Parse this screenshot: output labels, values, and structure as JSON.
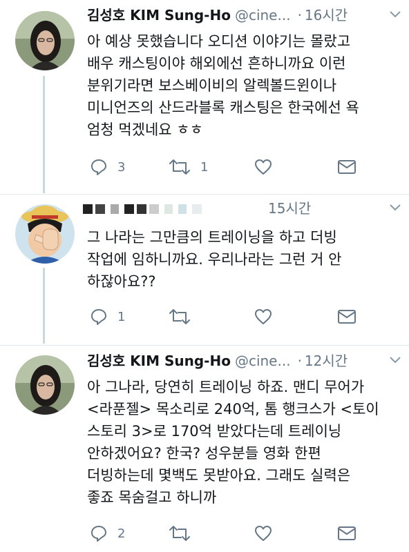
{
  "colors": {
    "text": "#14171a",
    "muted": "#657786",
    "line": "#ccd6dd",
    "divider": "#e1e8ed"
  },
  "tweets": [
    {
      "author_name": "김성호 KIM Sung-Ho",
      "handle": "@cine...",
      "separator": "·",
      "time": "16시간",
      "lines": [
        "아 예상 못했습니다 오디션 이야기는 몰랐고",
        "배우 캐스팅이야 해외에선 흔하니까요 이런",
        "분위기라면 보스베이비의 알렉볼드윈이나",
        "미니언즈의 산드라블록 캐스팅은 한국에선 욕",
        "엄청 먹겠네요 ㅎㅎ"
      ],
      "reply_count": "3",
      "retweet_count": "1",
      "icons": [
        "reply-icon",
        "retweet-icon",
        "like-icon",
        "message-icon",
        "chevron-down-icon"
      ]
    },
    {
      "author_name": "",
      "author_redacted": true,
      "handle": "",
      "separator": "",
      "time": "15시간",
      "lines": [
        "그 나라는 그만큼의 트레이닝을 하고 더빙",
        "작업에 임하니까요. 우리나라는 그런 거 안",
        "하잖아요??"
      ],
      "reply_count": "1",
      "retweet_count": "",
      "icons": [
        "reply-icon",
        "retweet-icon",
        "like-icon",
        "message-icon",
        "chevron-down-icon"
      ]
    },
    {
      "author_name": "김성호 KIM Sung-Ho",
      "handle": "@cine...",
      "separator": "·",
      "time": "12시간",
      "lines": [
        "아 그나라, 당연히 트레이닝 하죠. 맨디 무어가",
        "<라푼젤> 목소리로 240억, 톰 행크스가 <토이",
        "스토리 3>로 170억 받았다는데 트레이닝",
        "안하겠어요? 한국? 성우분들 영화 한편",
        "더빙하는데 몇백도 못받아요. 그래도 실력은",
        "좋죠 목숨걸고 하니까"
      ],
      "reply_count": "2",
      "retweet_count": "",
      "icons": [
        "reply-icon",
        "retweet-icon",
        "like-icon",
        "message-icon",
        "chevron-down-icon"
      ]
    }
  ]
}
